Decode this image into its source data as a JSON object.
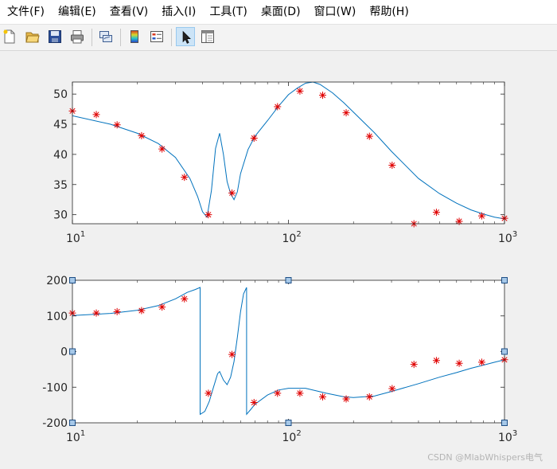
{
  "menu": [
    {
      "label": "文件(F)"
    },
    {
      "label": "编辑(E)"
    },
    {
      "label": "查看(V)"
    },
    {
      "label": "插入(I)"
    },
    {
      "label": "工具(T)"
    },
    {
      "label": "桌面(D)"
    },
    {
      "label": "窗口(W)"
    },
    {
      "label": "帮助(H)"
    }
  ],
  "toolbar": [
    {
      "icon": "new-figure-icon"
    },
    {
      "icon": "open-file-icon"
    },
    {
      "icon": "save-icon"
    },
    {
      "icon": "print-icon"
    },
    {
      "icon": "link-plot-icon"
    },
    {
      "icon": "insert-colorbar-icon"
    },
    {
      "icon": "insert-legend-icon"
    },
    {
      "icon": "edit-plot-arrow-icon",
      "active": true
    },
    {
      "icon": "property-editor-icon"
    }
  ],
  "colors": {
    "line": "#0072bd",
    "marker": "#e00000",
    "handle_fill": "#a6c8e8",
    "handle_stroke": "#1f4f86"
  },
  "watermark": "CSDN @MlabWhispers电气",
  "chart_data": [
    {
      "type": "line",
      "xscale": "log",
      "xlim": [
        10,
        1000
      ],
      "ylim": [
        28.5,
        52
      ],
      "yticks": [
        30,
        35,
        40,
        45,
        50
      ],
      "xticks": [
        {
          "base": "10",
          "exp": "1"
        },
        {
          "base": "10",
          "exp": "2"
        },
        {
          "base": "10",
          "exp": "3"
        }
      ],
      "series": [
        {
          "mark": "line",
          "x": [
            10,
            15,
            20,
            25,
            30,
            35,
            38,
            40,
            42,
            44,
            46,
            48,
            50,
            52,
            54,
            56,
            58,
            60,
            65,
            70,
            80,
            90,
            100,
            110,
            120,
            130,
            140,
            160,
            180,
            200,
            250,
            300,
            400,
            500,
            600,
            700,
            800,
            900,
            1000
          ],
          "y": [
            46.4,
            45.0,
            43.5,
            41.8,
            39.5,
            36.0,
            33.0,
            30.5,
            29.6,
            34.0,
            41.0,
            43.5,
            40.0,
            35.5,
            33.5,
            32.5,
            33.8,
            36.8,
            40.8,
            43.0,
            45.6,
            48.0,
            49.9,
            51.0,
            51.8,
            52.0,
            51.6,
            50.2,
            48.6,
            47.0,
            43.6,
            40.5,
            36.0,
            33.5,
            31.9,
            30.8,
            30.1,
            29.6,
            29.3
          ]
        },
        {
          "mark": "scatter",
          "x": [
            10,
            12.9,
            16.1,
            20.9,
            26.0,
            33.0,
            42.6,
            54.8,
            69.3,
            89.0,
            113,
            144,
            185,
            237,
            302,
            381,
            484,
            617,
            785,
            1000
          ],
          "y": [
            47.2,
            46.6,
            44.9,
            43.1,
            40.9,
            36.2,
            30.0,
            33.6,
            42.7,
            47.9,
            50.5,
            49.8,
            46.9,
            43.0,
            38.2,
            28.5,
            30.4,
            28.9,
            29.8,
            29.4
          ]
        }
      ]
    },
    {
      "type": "line",
      "xscale": "log",
      "xlim": [
        10,
        1000
      ],
      "ylim": [
        -200,
        200
      ],
      "yticks": [
        -200,
        -100,
        0,
        100,
        200
      ],
      "xticks": [
        {
          "base": "10",
          "exp": "1"
        },
        {
          "base": "10",
          "exp": "2"
        },
        {
          "base": "10",
          "exp": "3"
        }
      ],
      "series": [
        {
          "mark": "line",
          "x": [
            10,
            15,
            20,
            25,
            30,
            34,
            37,
            39,
            39,
            41,
            43,
            45,
            47,
            48,
            50,
            52,
            54,
            56,
            58,
            60,
            62,
            64,
            64,
            67,
            70,
            80,
            90,
            100,
            120,
            150,
            180,
            200,
            250,
            300,
            400,
            500,
            600,
            700,
            800,
            900,
            1000
          ],
          "y": [
            101,
            107,
            116,
            129,
            148,
            166,
            174,
            180,
            -176,
            -168,
            -140,
            -100,
            -62,
            -56,
            -80,
            -93,
            -72,
            -28,
            40,
            112,
            162,
            180,
            -176,
            -162,
            -148,
            -122,
            -108,
            -103,
            -103,
            -117,
            -127,
            -129,
            -125,
            -112,
            -90,
            -72,
            -59,
            -47,
            -38,
            -30,
            -23
          ]
        },
        {
          "mark": "scatter",
          "x": [
            10,
            12.9,
            16.1,
            20.9,
            26.0,
            33.0,
            42.6,
            54.8,
            69.3,
            89.0,
            113,
            144,
            185,
            237,
            302,
            381,
            484,
            617,
            785,
            1000
          ],
          "y": [
            108,
            108,
            112,
            115,
            125,
            148,
            -117,
            -8,
            -143,
            -117,
            -117,
            -127,
            -133,
            -127,
            -104,
            -36,
            -25,
            -33,
            -30,
            -23
          ]
        }
      ]
    }
  ]
}
